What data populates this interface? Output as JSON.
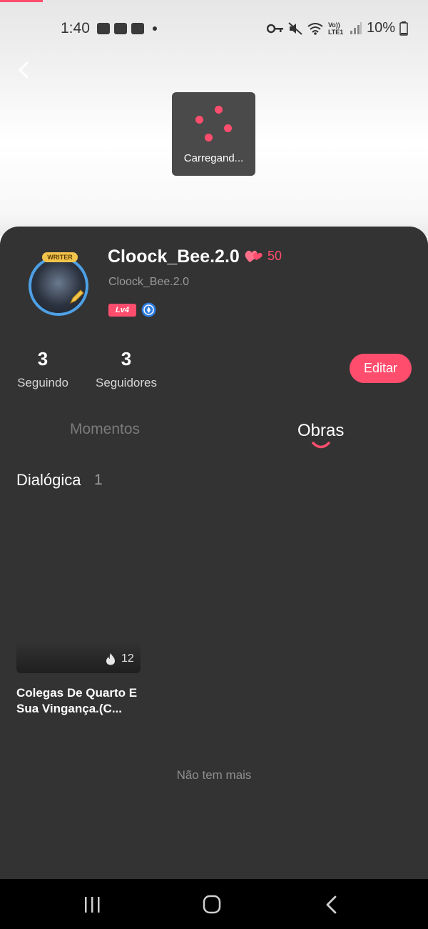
{
  "status_bar": {
    "time": "1:40",
    "battery": "10%",
    "left_icons": [
      "image-icon",
      "voicemail-icon",
      "youtube-icon",
      "dot-icon"
    ],
    "right_icons": [
      "key-icon",
      "mute-icon",
      "wifi-icon",
      "volte-icon",
      "signal-icon",
      "battery-icon"
    ],
    "volte_text": "Vo)) LTE1"
  },
  "toast": {
    "text": "Carregand..."
  },
  "profile": {
    "name": "Cloock_Bee.2.0",
    "handle": "Cloock_Bee.2.0",
    "hearts": "50",
    "level": "Lv4",
    "avatar_badge": "WRITER"
  },
  "stats": [
    {
      "value": "3",
      "label": "Seguindo"
    },
    {
      "value": "3",
      "label": "Seguidores"
    }
  ],
  "edit_button": "Editar",
  "tabs": [
    {
      "label": "Momentos",
      "active": false
    },
    {
      "label": "Obras",
      "active": true
    }
  ],
  "section": {
    "title": "Dialógica",
    "count": "1"
  },
  "works": [
    {
      "title": "Colegas De Quarto E Sua Vingança.(C...",
      "heat": "12"
    }
  ],
  "end_text": "Não tem mais",
  "colors": {
    "accent": "#ff4d6d",
    "sheet": "#333333",
    "navbar": "#000000"
  }
}
